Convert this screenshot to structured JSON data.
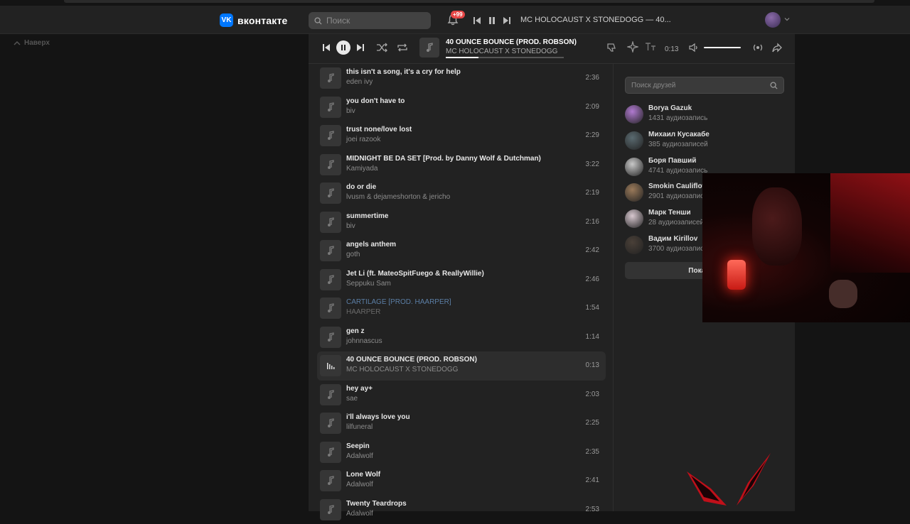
{
  "header": {
    "logo_text": "вконтакте",
    "logo_mark": "vk",
    "search_placeholder": "Поиск",
    "notif_badge": "+99",
    "now_playing": "MC HOLOCAUST X STONEDOGG — 40..."
  },
  "nav": {
    "back_label": "Наверх"
  },
  "player": {
    "title": "40 OUNCE BOUNCE (PROD. ROBSON)",
    "artist": "MC HOLOCAUST X STONEDOGG",
    "time": "0:13",
    "progress": 0.28,
    "volume": 1.0
  },
  "tracks": [
    {
      "title": "this isn't a song, it's a cry for help",
      "artist": "eden ivy",
      "duration": "2:36"
    },
    {
      "title": "you don't have to",
      "artist": "biv",
      "duration": "2:09"
    },
    {
      "title": "trust none/love lost",
      "artist": "joei razook",
      "duration": "2:29"
    },
    {
      "title": "MIDNIGHT BE DA SET [Prod. by Danny Wolf & Dutchman)",
      "artist": "Kamiyada",
      "duration": "3:22"
    },
    {
      "title": "do or die",
      "artist": "lvusm & dejameshorton & jericho",
      "duration": "2:19"
    },
    {
      "title": "summertime",
      "artist": "biv",
      "duration": "2:16"
    },
    {
      "title": "angels anthem",
      "artist": "goth",
      "duration": "2:42"
    },
    {
      "title": "Jet Li (ft. MateoSpitFuego & ReallyWillie)",
      "artist": "Seppuku Sam",
      "duration": "2:46"
    },
    {
      "title": "CARTILAGE [PROD. HAARPER]",
      "artist": "HAARPER",
      "duration": "1:54"
    },
    {
      "title": "gen z",
      "artist": "johnnascus",
      "duration": "1:14"
    },
    {
      "title": "40 OUNCE BOUNCE (PROD. ROBSON)",
      "artist": "MC HOLOCAUST X STONEDOGG",
      "duration": "0:13"
    },
    {
      "title": "hey ay+",
      "artist": "sae",
      "duration": "2:03"
    },
    {
      "title": "i'll always love you",
      "artist": "lilfuneral",
      "duration": "2:25"
    },
    {
      "title": "Seepin",
      "artist": "Adalwolf",
      "duration": "2:35"
    },
    {
      "title": "Lone Wolf",
      "artist": "Adalwolf",
      "duration": "2:41"
    },
    {
      "title": "Twenty Teardrops",
      "artist": "Adalwolf",
      "duration": "2:53"
    }
  ],
  "friends": {
    "search_placeholder": "Поиск друзей",
    "show_all": "Показать",
    "list": [
      {
        "name": "Borya Gazuk",
        "count": "1431 аудиозапись",
        "color": "#b07ad0"
      },
      {
        "name": "Михаил Кусакабе",
        "count": "385 аудиозаписей",
        "color": "#5a6a70"
      },
      {
        "name": "Боря Павший",
        "count": "4741 аудиозапись",
        "color": "#c8c8c8"
      },
      {
        "name": "Smokin Cauliflow",
        "count": "2901 аудиозапись",
        "color": "#9a7a5a"
      },
      {
        "name": "Марк Тенши",
        "count": "28 аудиозаписей",
        "color": "#d8c8d0"
      },
      {
        "name": "Вадим Kirillov",
        "count": "3700 аудиозаписей",
        "color": "#4a4038"
      }
    ]
  }
}
